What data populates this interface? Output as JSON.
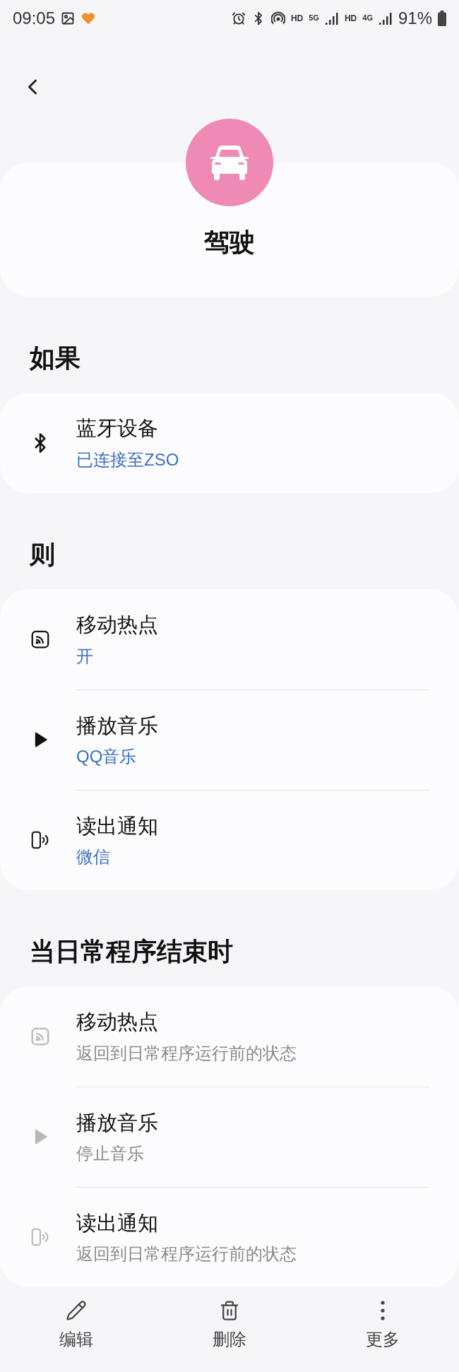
{
  "status_bar": {
    "time": "09:05",
    "network_labels": [
      {
        "kind": "hd",
        "text": "HD"
      },
      {
        "kind": "gen",
        "text": "5G"
      },
      {
        "kind": "hd",
        "text": "HD"
      },
      {
        "kind": "gen",
        "text": "4G"
      }
    ],
    "battery": "91%"
  },
  "routine": {
    "title": "驾驶"
  },
  "sections": [
    {
      "heading": "如果",
      "items": [
        {
          "kind": "bluetooth",
          "title": "蓝牙设备",
          "subtitle": "已连接至ZSO",
          "disabled": false
        }
      ]
    },
    {
      "heading": "则",
      "items": [
        {
          "kind": "hotspot",
          "title": "移动热点",
          "subtitle": "开",
          "disabled": false
        },
        {
          "kind": "play",
          "title": "播放音乐",
          "subtitle": "QQ音乐",
          "disabled": false
        },
        {
          "kind": "read",
          "title": "读出通知",
          "subtitle": "微信",
          "disabled": false
        }
      ]
    },
    {
      "heading": "当日常程序结束时",
      "items": [
        {
          "kind": "hotspot",
          "title": "移动热点",
          "subtitle": "返回到日常程序运行前的状态",
          "disabled": true
        },
        {
          "kind": "play",
          "title": "播放音乐",
          "subtitle": "停止音乐",
          "disabled": true
        },
        {
          "kind": "read",
          "title": "读出通知",
          "subtitle": "返回到日常程序运行前的状态",
          "disabled": true
        }
      ]
    }
  ],
  "bottom_bar": [
    {
      "kind": "edit",
      "label": "编辑"
    },
    {
      "kind": "delete",
      "label": "删除"
    },
    {
      "kind": "more",
      "label": "更多"
    }
  ]
}
